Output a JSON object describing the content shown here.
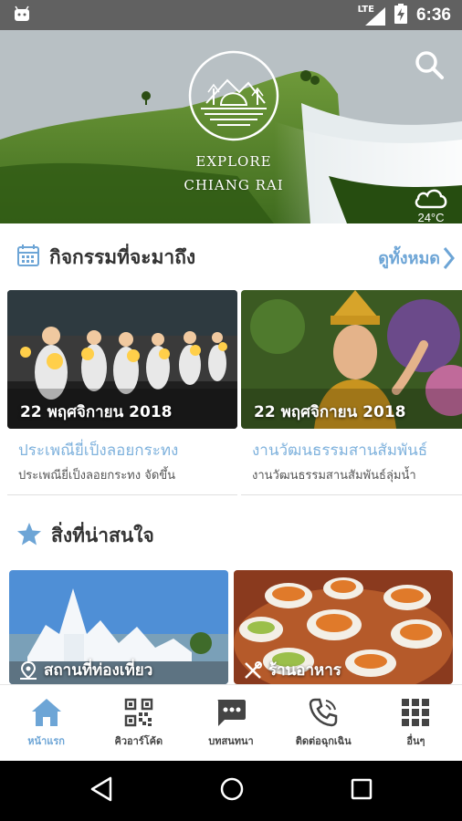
{
  "status_bar": {
    "network": "LTE",
    "time": "6:36"
  },
  "hero": {
    "brand_line1": "EXPLORE",
    "brand_line2": "CHIANG RAI",
    "weather_icon": "cloud-icon",
    "temperature": "24°C"
  },
  "events_section": {
    "title": "กิจกรรมที่จะมาถึง",
    "see_all_label": "ดูทั้งหมด",
    "items": [
      {
        "date": "22 พฤศจิกายน 2018",
        "title": "ประเพณียี่เป็งลอยกระทง",
        "description": "ประเพณียี่เป็งลอยกระทง จัดขึ้น"
      },
      {
        "date": "22 พฤศจิกายน 2018",
        "title": "งานวัฒนธรรมสานสัมพันธ์",
        "description": "งานวัฒนธรรมสานสัมพันธ์ลุ่มน้ำ"
      }
    ]
  },
  "attractions_section": {
    "title": "สิ่งที่น่าสนใจ",
    "items": [
      {
        "label": "สถานที่ท่องเที่ยว",
        "icon": "map-pin-icon"
      },
      {
        "label": "ร้านอาหาร",
        "icon": "utensils-icon"
      }
    ]
  },
  "bottom_nav": {
    "accent": "#6da5d6",
    "items": [
      {
        "label": "หน้าแรก",
        "icon": "home-icon",
        "active": true
      },
      {
        "label": "คิวอาร์โค้ด",
        "icon": "qr-code-icon",
        "active": false
      },
      {
        "label": "บทสนทนา",
        "icon": "chat-icon",
        "active": false
      },
      {
        "label": "ติดต่อฉุกเฉิน",
        "icon": "phone-icon",
        "active": false
      },
      {
        "label": "อื่นๆ",
        "icon": "grid-icon",
        "active": false
      }
    ]
  }
}
